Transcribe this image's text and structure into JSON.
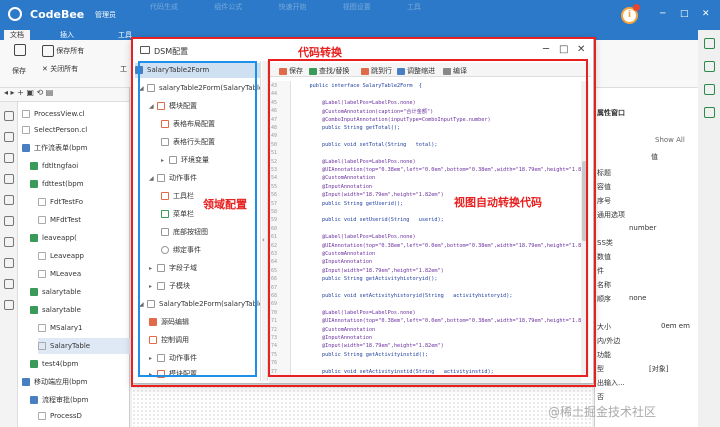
{
  "app": {
    "name": "CodeBee",
    "user": "管理员",
    "menu": [
      "代码生成",
      "组件公式",
      "快速开始",
      "视图设置",
      "工具"
    ],
    "notification_icon": "info-icon",
    "colors": {
      "titlebar": "#2b79c8",
      "annotation_red": "#e82020",
      "annotation_blue": "#1e90e8"
    }
  },
  "ribbon": {
    "tabs": [
      "文档",
      "插入",
      "工具"
    ],
    "buttons": {
      "save": "保存",
      "save_all": "保存所有",
      "close_all": "关闭所有",
      "tools": "工"
    }
  },
  "left_tree": {
    "items": [
      "ProcessView.cl",
      "SelectPerson.cl",
      "工作流表单(bpm",
      "fdtltngfaoi",
      "fdttest(bpm",
      "FdtTestFo",
      "MFdtTest",
      "leaveapp(",
      "Leaveapp",
      "MLeavea",
      "salarytable",
      "salarytable",
      "MSalary1",
      "SalaryTable",
      "test4(bpm",
      "移动端应用(bpm",
      "流程审批(bpm",
      "ProcessD"
    ]
  },
  "dialog": {
    "title": "DSM配置",
    "root": "SalaryTable2Form",
    "items": [
      "salaryTable2Form(SalaryTable",
      "模块配置",
      "表格布局配置",
      "表格行头配置",
      "环境变量",
      "动作事件",
      "工具栏",
      "菜单栏",
      "底部按钮图",
      "绑定事件",
      "字段子域",
      "子模块",
      "SalaryTable2Form(salaryTable",
      "源码编辑",
      "控制调用",
      "动作事件",
      "模块配置",
      "视图配置"
    ],
    "toolbar": [
      "保存",
      "查找/替换",
      "跳到行",
      "调整缩进",
      "编译"
    ],
    "code_lines": [
      {
        "n": "43",
        "t": "    public interface SalaryTable2Form  {"
      },
      {
        "n": "44",
        "t": ""
      },
      {
        "n": "45",
        "t": "        @Label(labelPos=LabelPos.none)"
      },
      {
        "n": "46",
        "t": "        @CustomAnnotation(caption=\"合计金额\")"
      },
      {
        "n": "47",
        "t": "        @ComboInputAnnotation(inputType=ComboInputType.number)"
      },
      {
        "n": "48",
        "t": "        public String getTotal();"
      },
      {
        "n": "49",
        "t": ""
      },
      {
        "n": "50",
        "t": "        public void setTotal(String   total);"
      },
      {
        "n": "51",
        "t": ""
      },
      {
        "n": "52",
        "t": "        @Label(labelPos=LabelPos.none)"
      },
      {
        "n": "53",
        "t": "        @UIAnnotation(top=\"0.38em\",left=\"0.0em\",bottom=\"0.38em\",width=\"18.79em\",height=\"1.82em\")"
      },
      {
        "n": "54",
        "t": "        @CustomAnnotation"
      },
      {
        "n": "55",
        "t": "        @InputAnnotation"
      },
      {
        "n": "56",
        "t": "        @Input(width=\"18.79em\",height=\"1.82em\")"
      },
      {
        "n": "57",
        "t": "        public String getUserid();"
      },
      {
        "n": "58",
        "t": ""
      },
      {
        "n": "59",
        "t": "        public void setUserid(String   userid);"
      },
      {
        "n": "60",
        "t": ""
      },
      {
        "n": "61",
        "t": "        @Label(labelPos=LabelPos.none)"
      },
      {
        "n": "62",
        "t": "        @UIAnnotation(top=\"0.38em\",left=\"0.0em\",bottom=\"0.38em\",width=\"18.79em\",height=\"1.82em\")"
      },
      {
        "n": "63",
        "t": "        @CustomAnnotation"
      },
      {
        "n": "64",
        "t": "        @InputAnnotation"
      },
      {
        "n": "65",
        "t": "        @Input(width=\"18.79em\",height=\"1.82em\")"
      },
      {
        "n": "66",
        "t": "        public String getActivityhistoryid();"
      },
      {
        "n": "67",
        "t": ""
      },
      {
        "n": "68",
        "t": "        public void setActivityhistoryid(String   activityhistoryid);"
      },
      {
        "n": "69",
        "t": ""
      },
      {
        "n": "70",
        "t": "        @Label(labelPos=LabelPos.none)"
      },
      {
        "n": "71",
        "t": "        @UIAnnotation(top=\"0.38em\",left=\"0.0em\",bottom=\"0.38em\",width=\"18.79em\",height=\"1.82em\")"
      },
      {
        "n": "72",
        "t": "        @CustomAnnotation"
      },
      {
        "n": "73",
        "t": "        @InputAnnotation"
      },
      {
        "n": "74",
        "t": "        @Input(width=\"18.79em\",height=\"1.82em\")"
      },
      {
        "n": "75",
        "t": "        public String getActivityinstid();"
      },
      {
        "n": "76",
        "t": ""
      },
      {
        "n": "77",
        "t": "        public void setActivityinstid(String   activityinstid);"
      }
    ]
  },
  "annotations": {
    "code_convert": "代码转换",
    "domain_config": "领域配置",
    "view_auto_convert": "视图自动转换代码"
  },
  "right_panel": {
    "title": "属性窗口",
    "show_all": "Show All",
    "col_value": "值",
    "rows": [
      "标题",
      "容值",
      "序号",
      "通用选项",
      "number",
      "SS类",
      "数值",
      "件",
      "名称",
      "顺序",
      "none",
      "大小",
      "0em em",
      "内/外边",
      "功能",
      "型",
      "[对象]",
      "出输入...",
      "否"
    ]
  },
  "watermark": "@稀土掘金技术社区"
}
